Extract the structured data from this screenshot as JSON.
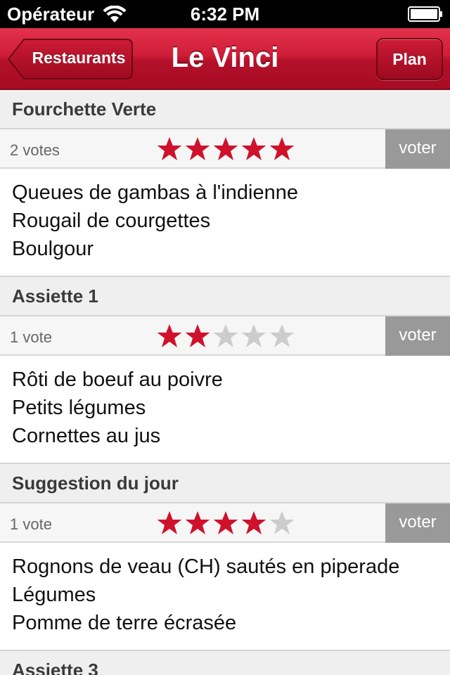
{
  "status_bar": {
    "carrier": "Opérateur",
    "time": "6:32 PM"
  },
  "nav": {
    "back_label": "Restaurants",
    "title": "Le Vinci",
    "plan_label": "Plan"
  },
  "colors": {
    "nav_red": "#c8102e",
    "star_filled": "#d0112b",
    "star_empty": "#cccccc",
    "vote_button": "#999999"
  },
  "menu": [
    {
      "name": "Fourchette Verte",
      "votes_label": "2 votes",
      "rating": 5,
      "vote_label": "voter",
      "dishes": [
        "Queues de gambas à l'indienne",
        "Rougail de courgettes",
        "Boulgour"
      ]
    },
    {
      "name": "Assiette 1",
      "votes_label": "1 vote",
      "rating": 2,
      "vote_label": "voter",
      "dishes": [
        "Rôti de boeuf au poivre",
        "Petits légumes",
        "Cornettes au jus"
      ]
    },
    {
      "name": "Suggestion du jour",
      "votes_label": "1 vote",
      "rating": 4,
      "vote_label": "voter",
      "dishes": [
        "Rognons de veau (CH) sautés en piperade",
        "Légumes",
        "Pomme de terre écrasée"
      ]
    },
    {
      "name": "Assiette 3"
    }
  ]
}
